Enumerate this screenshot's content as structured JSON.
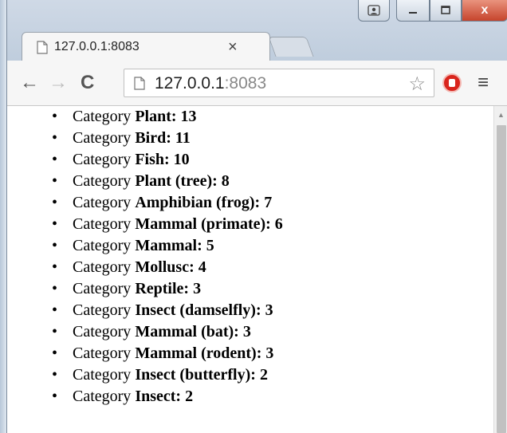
{
  "browser": {
    "tab_title": "127.0.0.1:8083",
    "tab_close": "×",
    "url_host": "127.0.0.1",
    "url_port": ":8083",
    "back_icon": "←",
    "forward_icon": "→",
    "reload_icon": "C",
    "star_icon": "☆",
    "menu_icon": "≡",
    "close_glyph": "x"
  },
  "list": {
    "items": [
      {
        "prefix": "Category ",
        "category": "Plant",
        "count": ": 13"
      },
      {
        "prefix": "Category ",
        "category": "Bird",
        "count": ": 11"
      },
      {
        "prefix": "Category ",
        "category": "Fish",
        "count": ": 10"
      },
      {
        "prefix": "Category ",
        "category": "Plant (tree)",
        "count": ": 8"
      },
      {
        "prefix": "Category ",
        "category": "Amphibian (frog)",
        "count": ": 7"
      },
      {
        "prefix": "Category ",
        "category": "Mammal (primate)",
        "count": ": 6"
      },
      {
        "prefix": "Category ",
        "category": "Mammal",
        "count": ": 5"
      },
      {
        "prefix": "Category ",
        "category": "Mollusc",
        "count": ": 4"
      },
      {
        "prefix": "Category ",
        "category": "Reptile",
        "count": ": 3"
      },
      {
        "prefix": "Category ",
        "category": "Insect (damselfly)",
        "count": ": 3"
      },
      {
        "prefix": "Category ",
        "category": "Mammal (bat)",
        "count": ": 3"
      },
      {
        "prefix": "Category ",
        "category": "Mammal (rodent)",
        "count": ": 3"
      },
      {
        "prefix": "Category ",
        "category": "Insect (butterfly)",
        "count": ": 2"
      },
      {
        "prefix": "Category ",
        "category": "Insect",
        "count": ": 2"
      }
    ]
  }
}
